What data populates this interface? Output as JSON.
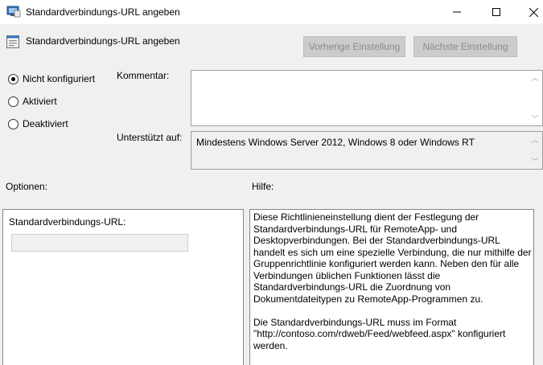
{
  "window": {
    "title": "Standardverbindungs-URL angeben"
  },
  "header": {
    "title": "Standardverbindungs-URL angeben",
    "prev_button": "Vorherige Einstellung",
    "next_button": "Nächste Einstellung"
  },
  "state": {
    "options": [
      {
        "label": "Nicht konfiguriert",
        "checked": true
      },
      {
        "label": "Aktiviert",
        "checked": false
      },
      {
        "label": "Deaktiviert",
        "checked": false
      }
    ]
  },
  "comment": {
    "label": "Kommentar:",
    "value": ""
  },
  "supported": {
    "label": "Unterstützt auf:",
    "value": "Mindestens Windows Server 2012, Windows 8 oder Windows RT"
  },
  "options_section": {
    "heading": "Optionen:",
    "url_label": "Standardverbindungs-URL:",
    "url_value": ""
  },
  "help_section": {
    "heading": "Hilfe:",
    "paragraphs": [
      "Diese Richtlinieneinstellung dient der Festlegung der Standardverbindungs-URL für RemoteApp- und Desktopverbindungen. Bei der Standardverbindungs-URL handelt es sich um eine spezielle Verbindung, die nur mithilfe der Gruppenrichtlinie konfiguriert werden kann. Neben den für alle Verbindungen üblichen Funktionen lässt die Standardverbindungs-URL die Zuordnung von Dokumentdateitypen zu RemoteApp-Programmen zu.",
      "Die Standardverbindungs-URL muss im Format \"http://contoso.com/rdweb/Feed/webfeed.aspx\" konfiguriert werden."
    ]
  }
}
